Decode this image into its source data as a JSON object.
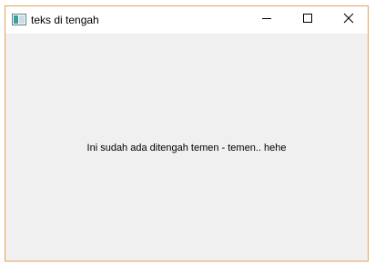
{
  "window": {
    "title": "teks di tengah",
    "border_color": "#e3a35a",
    "client_background": "#f0f0f0",
    "controls": {
      "minimize_icon": "minimize-icon",
      "maximize_icon": "maximize-icon",
      "close_icon": "close-icon"
    }
  },
  "content": {
    "label": "Ini sudah ada ditengah temen - temen.. hehe"
  }
}
